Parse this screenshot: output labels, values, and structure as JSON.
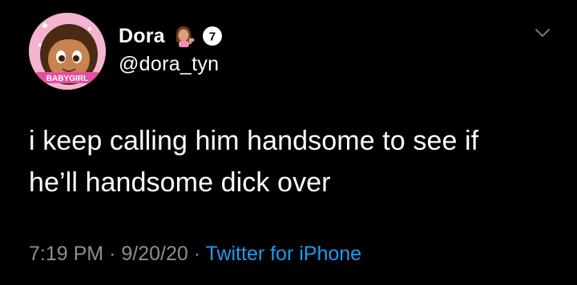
{
  "author": {
    "display_name": "Dora",
    "handle": "@dora_tyn",
    "avatar_icon": "avatar-cartoon-girl-icon",
    "avatar_caption": "BABYGIRL",
    "name_emoji": "woman-tipping-hand-emoji",
    "badge_text": "7"
  },
  "tweet": {
    "lines": [
      "i keep calling him handsome to see if",
      "he’ll handsome dick over"
    ]
  },
  "meta": {
    "time": "7:19 PM",
    "separator": "·",
    "date": "9/20/20",
    "source": "Twitter for iPhone"
  },
  "colors": {
    "background": "#000000",
    "text": "#ffffff",
    "muted": "#8b8f94",
    "link": "#1d9bf0"
  }
}
